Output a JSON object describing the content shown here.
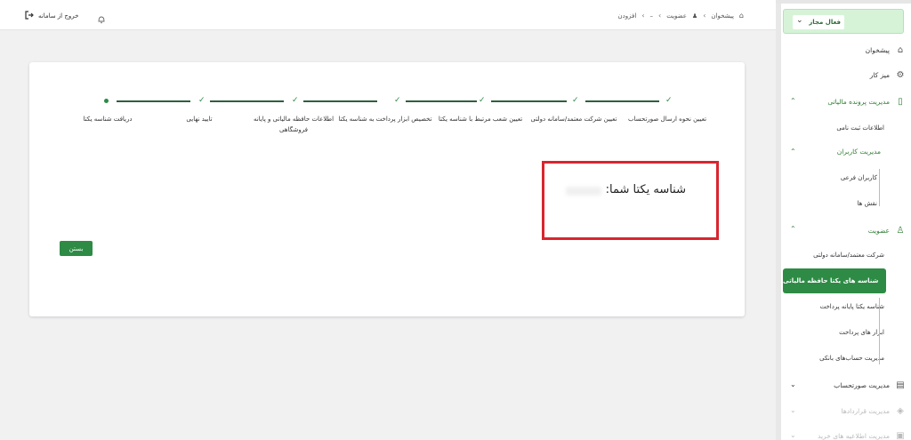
{
  "header": {
    "logout_label": "خروج از سامانه",
    "breadcrumb": [
      "پیشخوان",
      "عضویت",
      "–",
      "افزودن"
    ]
  },
  "sidebar": {
    "status": "فعال مجاز",
    "items": [
      {
        "label": "پیشخوان",
        "icon": "home-icon"
      },
      {
        "label": "میز کار",
        "icon": "desk-icon"
      },
      {
        "label": "مدیریت پرونده مالیاتی",
        "icon": "file-icon"
      },
      {
        "label": "اطلاعات ثبت نامی"
      },
      {
        "label": "مدیریت کاربران"
      },
      {
        "label": "کاربران فرعی"
      },
      {
        "label": "نقش ها"
      },
      {
        "label": "عضویت",
        "icon": "user-icon"
      },
      {
        "label": "شرکت معتمد/سامانه دولتی"
      },
      {
        "label": "شناسه های یکتا حافظه مالیاتی"
      },
      {
        "label": "شناسه یکتا پایانه پرداخت"
      },
      {
        "label": "ابزار های پرداخت"
      },
      {
        "label": "مدیریت حساب‌های بانکی"
      },
      {
        "label": "مدیریت صورتحساب",
        "icon": "invoice-icon"
      },
      {
        "label": "مدیریت قراردادها",
        "icon": "contract-icon"
      },
      {
        "label": "مدیریت اطلاعیه های خرید",
        "icon": "notice-icon"
      }
    ]
  },
  "steps": [
    "تعیین نحوه ارسال صورتحساب",
    "تعیین شرکت معتمد/سامانه دولتی",
    "تعیین شعب مرتبط با شناسه یکتا",
    "تخصیص ابزار پرداخت به شناسه یکتا",
    "اطلاعات حافظه مالیاتی و پایانه فروشگاهی",
    "تایید نهایی",
    "دریافت شناسه یکتا"
  ],
  "dialog": {
    "id_label": "شناسه یکتا شما:",
    "close_label": "بستن"
  }
}
